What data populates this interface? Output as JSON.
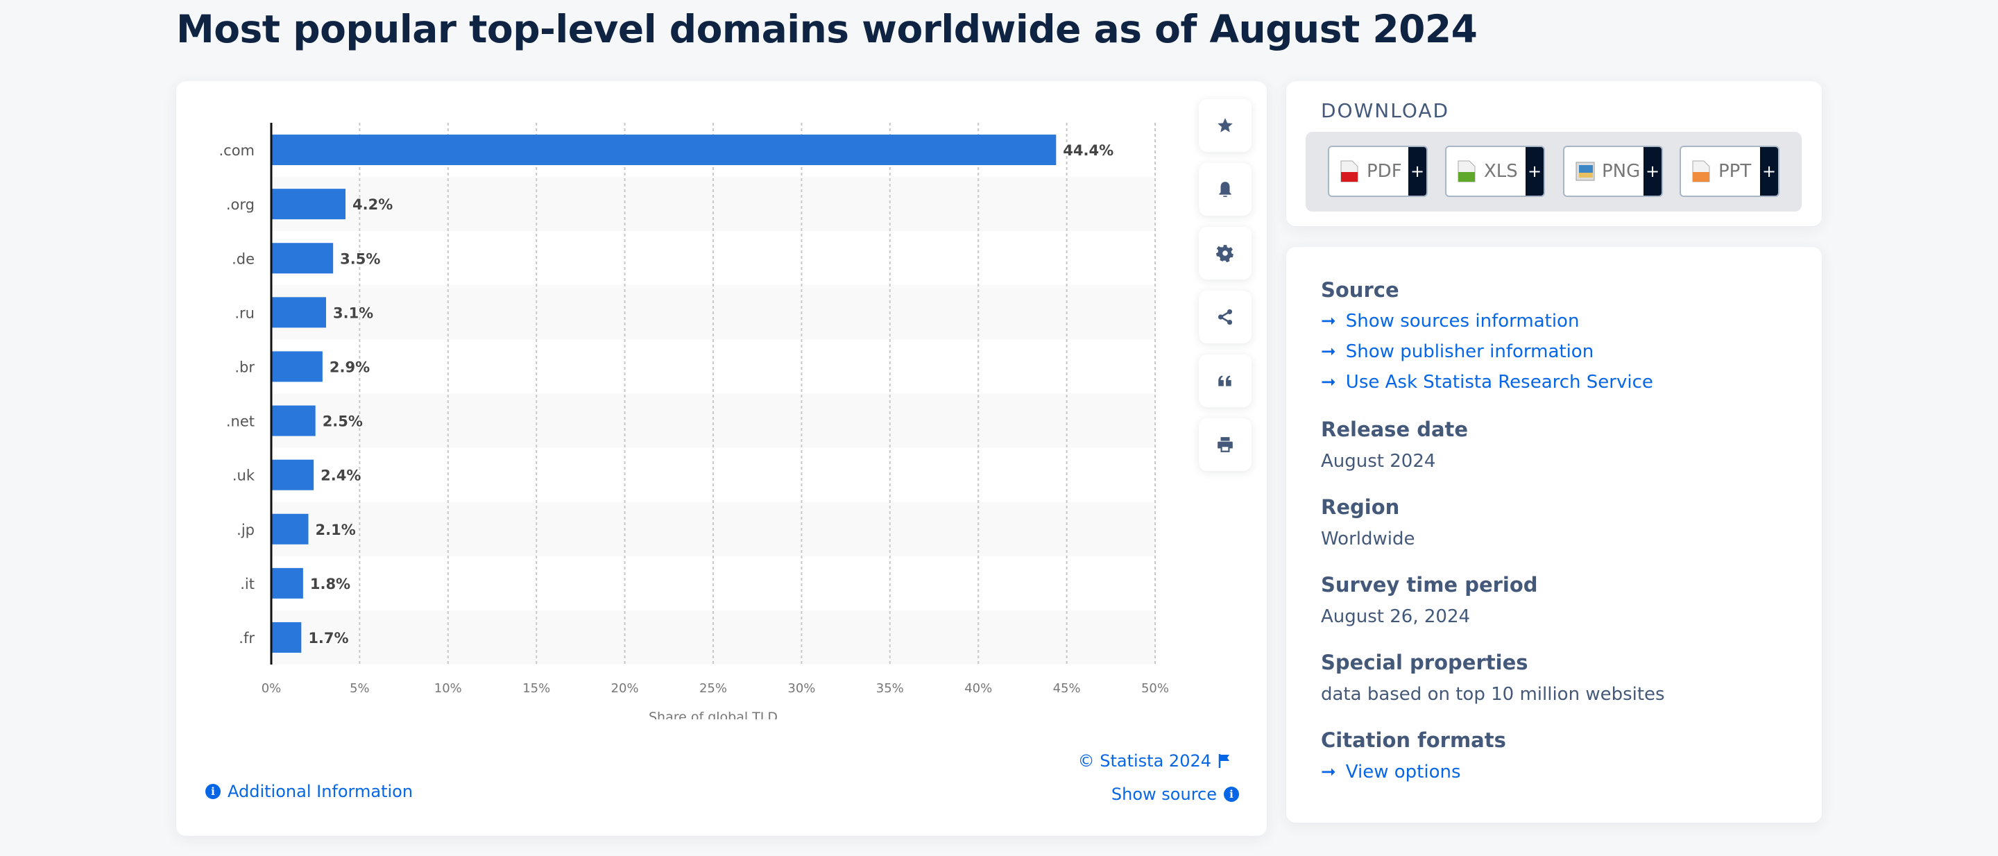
{
  "page": {
    "title": "Most popular top-level domains worldwide as of August 2024"
  },
  "colors": {
    "bar": "#2977db",
    "link": "#0666e5",
    "heading": "#44597a",
    "title": "#0f2342"
  },
  "chart_data": {
    "type": "bar",
    "orientation": "horizontal",
    "title": "Most popular top-level domains worldwide as of August 2024",
    "categories": [
      ".com",
      ".org",
      ".de",
      ".ru",
      ".br",
      ".net",
      ".uk",
      ".jp",
      ".it",
      ".fr"
    ],
    "values": [
      44.4,
      4.2,
      3.5,
      3.1,
      2.9,
      2.5,
      2.4,
      2.1,
      1.8,
      1.7
    ],
    "value_labels": [
      "44.4%",
      "4.2%",
      "3.5%",
      "3.1%",
      "2.9%",
      "2.5%",
      "2.4%",
      "2.1%",
      "1.8%",
      "1.7%"
    ],
    "xlabel": "Share of global TLD",
    "ylabel": "",
    "xlim": [
      0,
      50
    ],
    "xticks": [
      0,
      5,
      10,
      15,
      20,
      25,
      30,
      35,
      40,
      45,
      50
    ],
    "xtick_labels": [
      "0%",
      "5%",
      "10%",
      "15%",
      "20%",
      "25%",
      "30%",
      "35%",
      "40%",
      "45%",
      "50%"
    ],
    "grid": true,
    "legend": "none"
  },
  "toolbar": {
    "buttons": [
      {
        "name": "favorite",
        "icon": "star-icon"
      },
      {
        "name": "notifications",
        "icon": "bell-icon"
      },
      {
        "name": "settings",
        "icon": "gear-icon"
      },
      {
        "name": "share",
        "icon": "share-icon"
      },
      {
        "name": "cite",
        "icon": "quote-icon"
      },
      {
        "name": "print",
        "icon": "print-icon"
      }
    ]
  },
  "chart_footer": {
    "copyright": "© Statista 2024",
    "additional_info": "Additional Information",
    "show_source": "Show source"
  },
  "download": {
    "title": "DOWNLOAD",
    "formats": [
      {
        "label": "PDF",
        "icon": "pdf-file-icon",
        "color": "#d71920"
      },
      {
        "label": "XLS",
        "icon": "xls-file-icon",
        "color": "#5fa82c"
      },
      {
        "label": "PNG",
        "icon": "png-file-icon",
        "color": "#3d86c6"
      },
      {
        "label": "PPT",
        "icon": "ppt-file-icon",
        "color": "#f08c3c"
      }
    ],
    "plus": "+"
  },
  "info": {
    "source_heading": "Source",
    "source_links": [
      "Show sources information",
      "Show publisher information",
      "Use Ask Statista Research Service"
    ],
    "release_heading": "Release date",
    "release_value": "August 2024",
    "region_heading": "Region",
    "region_value": "Worldwide",
    "survey_heading": "Survey time period",
    "survey_value": "August 26, 2024",
    "special_heading": "Special properties",
    "special_value": "data based on top 10 million websites",
    "citation_heading": "Citation formats",
    "citation_link": "View options",
    "arrow": "➞"
  }
}
